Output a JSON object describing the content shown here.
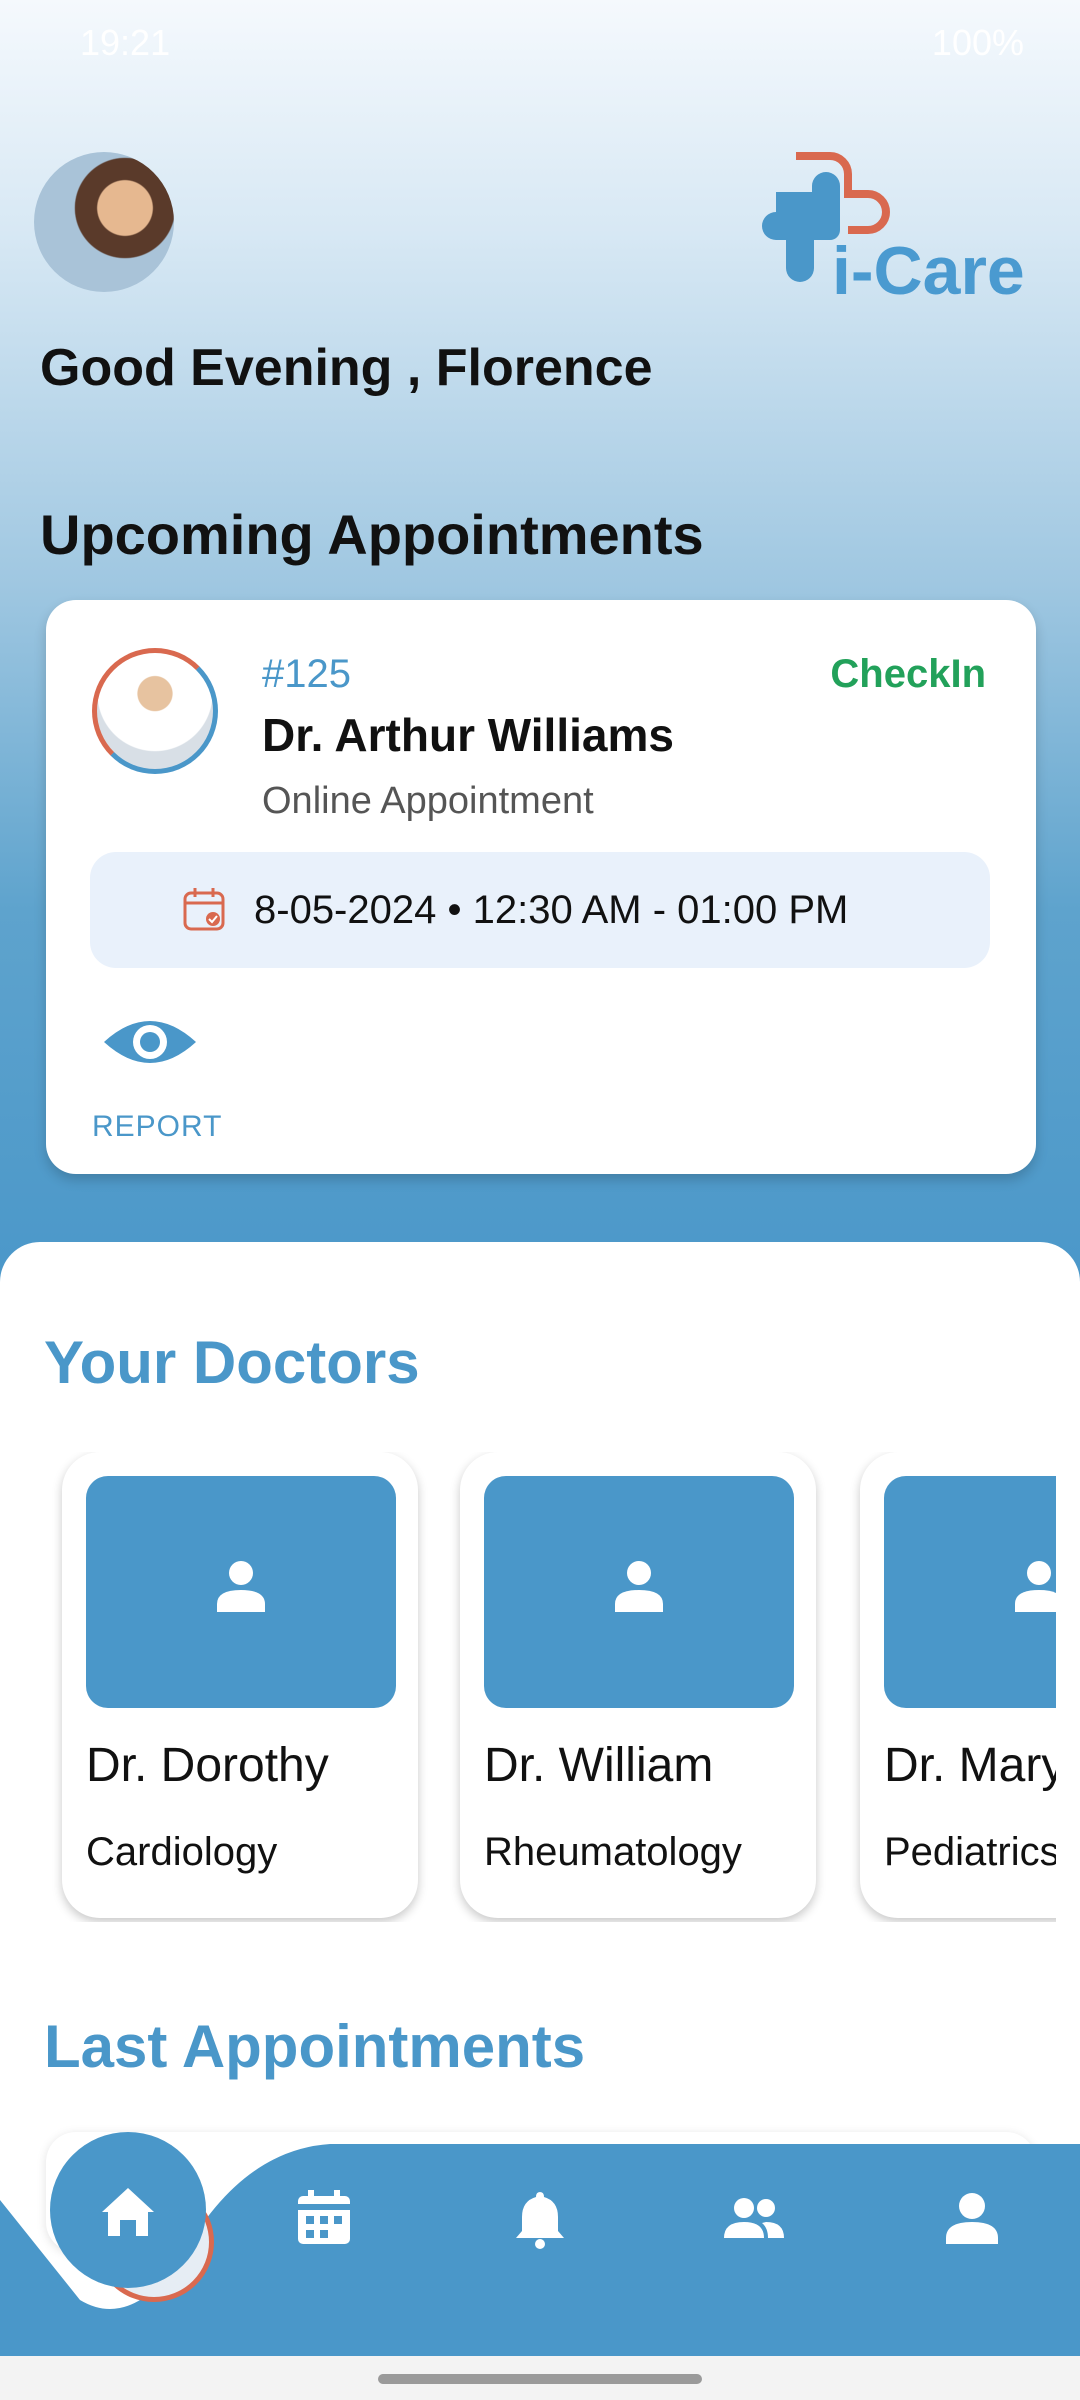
{
  "status_bar": {
    "time": "19:21",
    "battery": "100%"
  },
  "brand": {
    "logo_text": "i-Care",
    "accent_blue": "#4a97c9",
    "accent_red": "#d9694f"
  },
  "header": {
    "greeting": "Good Evening , Florence"
  },
  "upcoming": {
    "title": "Upcoming Appointments",
    "appointment": {
      "id": "#125",
      "status": "CheckIn",
      "doctor": "Dr. Arthur Williams",
      "type": "Online Appointment",
      "date_time": "8-05-2024  •  12:30 AM - 01:00 PM",
      "report_label": "REPORT"
    }
  },
  "your_doctors": {
    "title": "Your Doctors",
    "items": [
      {
        "name": "Dr. Dorothy",
        "specialty": "Cardiology"
      },
      {
        "name": "Dr. William",
        "specialty": "Rheumatology"
      },
      {
        "name": "Dr. Mary",
        "specialty": "Pediatrics"
      }
    ]
  },
  "last_appointments": {
    "title": "Last Appointments"
  },
  "bottom_nav": {
    "items": [
      "home-icon",
      "calendar-icon",
      "bell-icon",
      "group-icon",
      "profile-icon"
    ],
    "active": "home-icon"
  }
}
